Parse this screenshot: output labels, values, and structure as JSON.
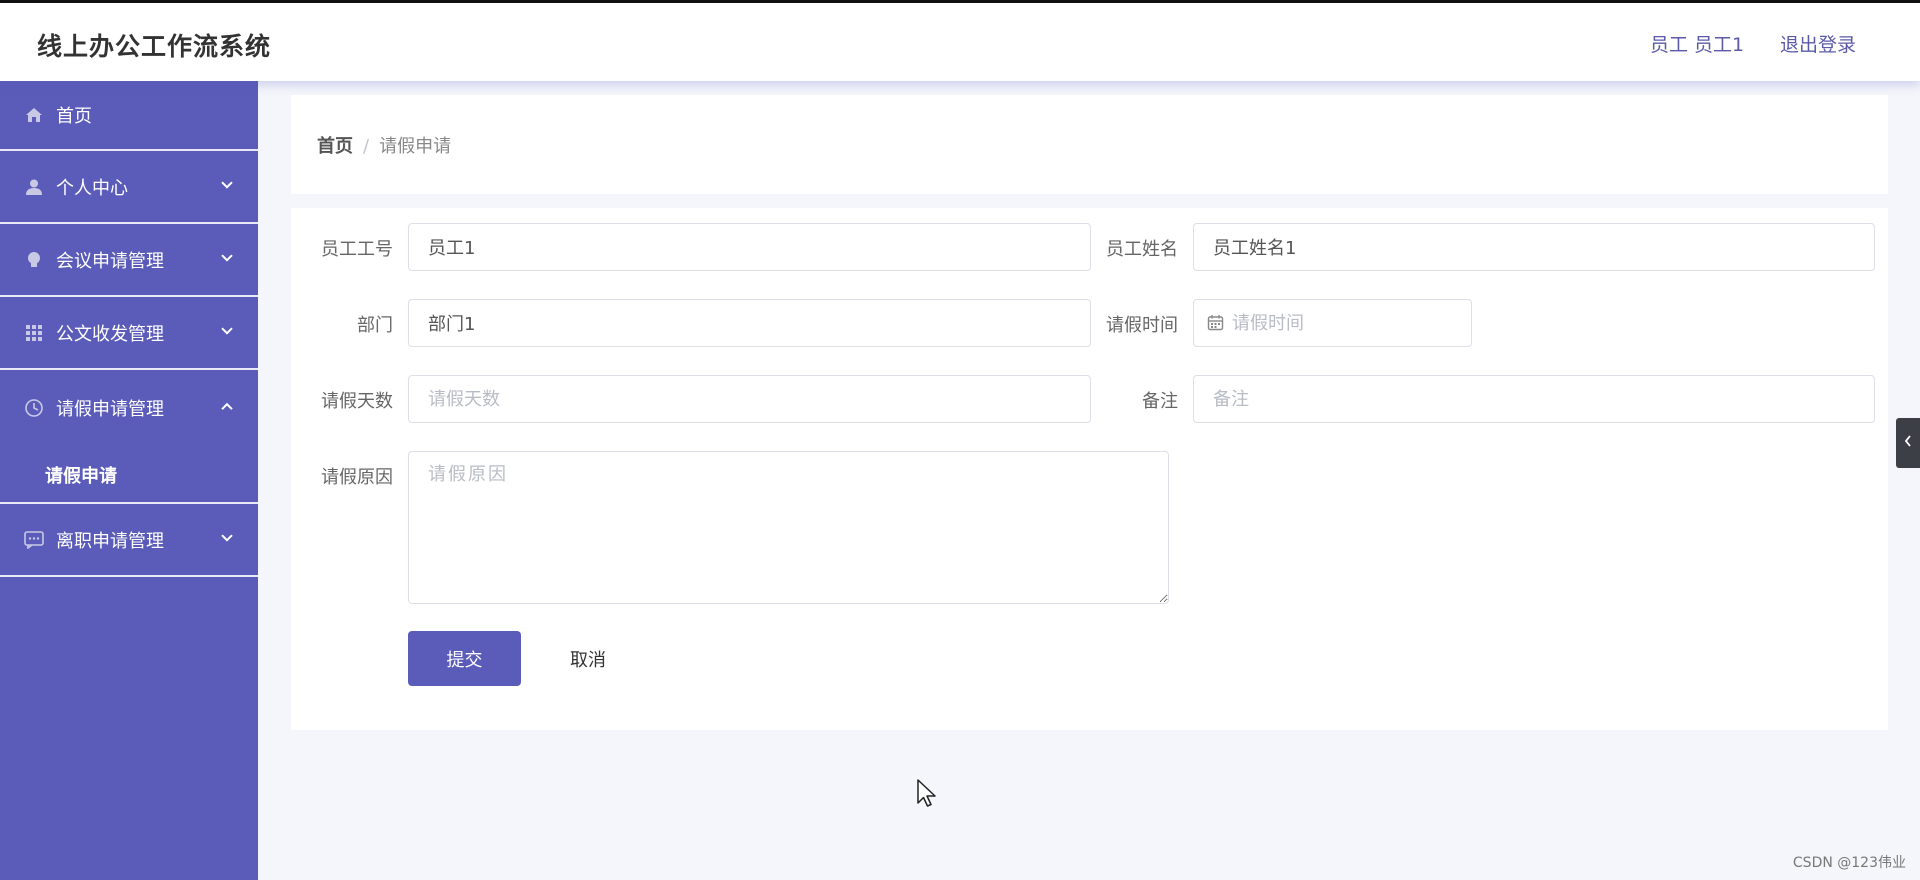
{
  "header": {
    "title": "线上办公工作流系统",
    "user": "员工 员工1",
    "logout": "退出登录"
  },
  "sidebar": {
    "items": [
      {
        "label": "首页",
        "icon": "home-icon"
      },
      {
        "label": "个人中心",
        "icon": "user-icon"
      },
      {
        "label": "会议申请管理",
        "icon": "lightbulb-icon"
      },
      {
        "label": "公文收发管理",
        "icon": "grid-icon"
      },
      {
        "label": "请假申请管理",
        "icon": "clock-icon",
        "expanded": true,
        "children": [
          {
            "label": "请假申请"
          }
        ]
      },
      {
        "label": "离职申请管理",
        "icon": "chat-icon"
      }
    ]
  },
  "breadcrumb": {
    "home": "首页",
    "separator": "/",
    "current": "请假申请"
  },
  "form": {
    "employee_no": {
      "label": "员工工号",
      "value": "员工1"
    },
    "employee_name": {
      "label": "员工姓名",
      "value": "员工姓名1"
    },
    "department": {
      "label": "部门",
      "value": "部门1"
    },
    "leave_time": {
      "label": "请假时间",
      "placeholder": "请假时间"
    },
    "leave_days": {
      "label": "请假天数",
      "placeholder": "请假天数"
    },
    "remark": {
      "label": "备注",
      "placeholder": "备注"
    },
    "reason": {
      "label": "请假原因",
      "placeholder": "请假原因"
    },
    "submit": "提交",
    "cancel": "取消"
  },
  "side_tab_icon": "chevron-left-icon",
  "watermark": "CSDN @123伟业",
  "colors": {
    "primary": "#5b5bb9",
    "background": "#f4f6fb"
  }
}
